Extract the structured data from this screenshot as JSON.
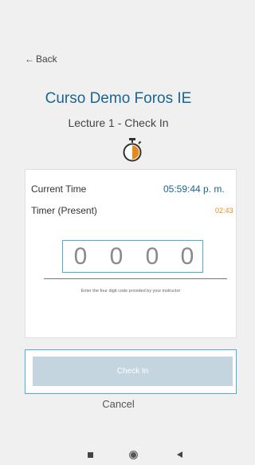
{
  "nav": {
    "back_label": "Back"
  },
  "course": {
    "title": "Curso Demo Foros IE",
    "lecture": "Lecture 1 - Check In"
  },
  "stats": {
    "current_time_label": "Current Time",
    "current_time_value": "05:59:44 p. m.",
    "timer_label": "Timer (Present)",
    "timer_value": "02:43"
  },
  "code": {
    "digits": [
      "0",
      "0",
      "0",
      "0"
    ],
    "hint": "Enter the four digit code provided by your instructor"
  },
  "actions": {
    "checkin_label": "Check In",
    "cancel_label": "Cancel"
  },
  "colors": {
    "accent": "#1a6691",
    "timer": "#e8881a",
    "focus_border": "#4ab0d4",
    "button_disabled": "#c4d5e0"
  },
  "icons": {
    "back": "back-arrow-icon",
    "timer": "stopwatch-icon"
  }
}
